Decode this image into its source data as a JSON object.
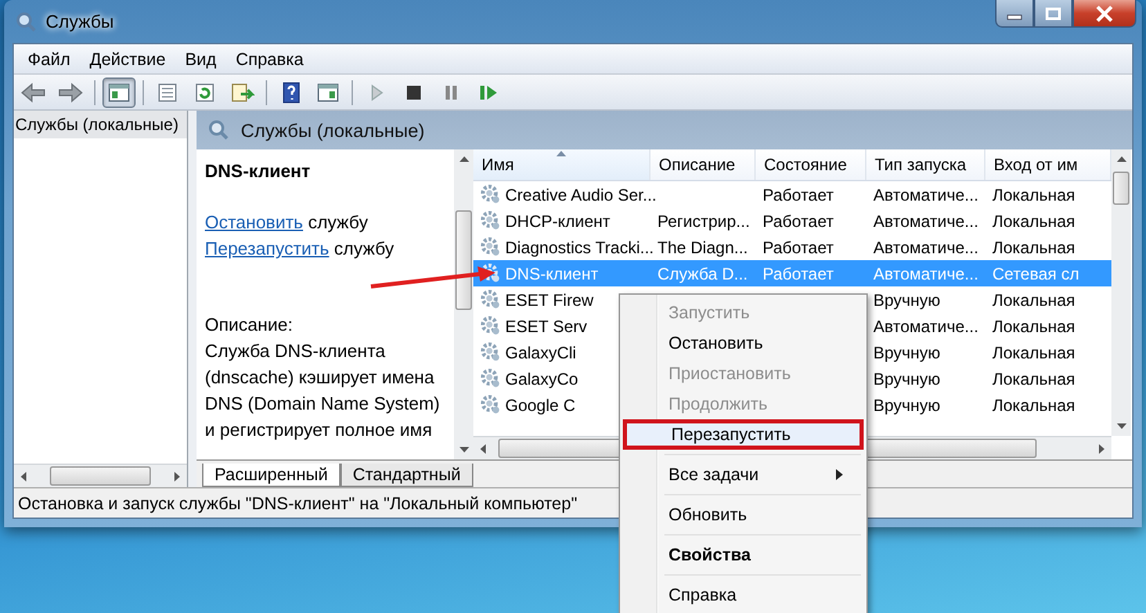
{
  "window": {
    "title": "Службы"
  },
  "menu_bar": [
    "Файл",
    "Действие",
    "Вид",
    "Справка"
  ],
  "toolbar": [
    {
      "kind": "back",
      "pressed": false
    },
    {
      "kind": "forward",
      "pressed": false
    },
    {
      "kind": "sep"
    },
    {
      "kind": "tree",
      "pressed": true
    },
    {
      "kind": "sep"
    },
    {
      "kind": "properties",
      "pressed": false
    },
    {
      "kind": "refresh",
      "pressed": false
    },
    {
      "kind": "export",
      "pressed": false
    },
    {
      "kind": "sep"
    },
    {
      "kind": "help",
      "pressed": false
    },
    {
      "kind": "pane",
      "pressed": false
    },
    {
      "kind": "sep"
    },
    {
      "kind": "play",
      "pressed": false
    },
    {
      "kind": "stop",
      "pressed": false
    },
    {
      "kind": "pause",
      "pressed": false
    },
    {
      "kind": "resume",
      "pressed": false
    }
  ],
  "tree": {
    "items": [
      {
        "label": "Службы (локальные)",
        "selected": true
      }
    ]
  },
  "pane": {
    "title": "Службы (локальные)"
  },
  "details": {
    "service_name": "DNS-клиент",
    "actions": [
      {
        "link": "Остановить",
        "text": "службу"
      },
      {
        "link": "Перезапустить",
        "text": "службу"
      }
    ],
    "description_label": "Описание:",
    "description": "Служба DNS-клиента (dnscache) кэширует имена DNS (Domain Name System) и регистрирует полное имя"
  },
  "table": {
    "columns": [
      {
        "label": "Имя",
        "sorted": true
      },
      {
        "label": "Описание",
        "sorted": false
      },
      {
        "label": "Состояние",
        "sorted": false
      },
      {
        "label": "Тип запуска",
        "sorted": false
      },
      {
        "label": "Вход от им",
        "sorted": false
      }
    ],
    "rows": [
      {
        "name": "Creative Audio Ser...",
        "status": "Работает",
        "startup": "Автоматиче...",
        "logon": "Локальная",
        "selected": false
      },
      {
        "name": "DHCP-клиент",
        "description": "Регистрир...",
        "status": "Работает",
        "startup": "Автоматиче...",
        "logon": "Локальная",
        "selected": false
      },
      {
        "name": "Diagnostics Tracki...",
        "description": "The Diagn...",
        "status": "Работает",
        "startup": "Автоматиче...",
        "logon": "Локальная",
        "selected": false
      },
      {
        "name": "DNS-клиент",
        "description": "Служба D...",
        "status": "Работает",
        "startup": "Автоматиче...",
        "logon": "Сетевая сл",
        "selected": true
      },
      {
        "name": "ESET Firew",
        "startup": "Вручную",
        "logon": "Локальная",
        "selected": false
      },
      {
        "name": "ESET Serv",
        "startup": "Автоматиче...",
        "logon": "Локальная",
        "selected": false
      },
      {
        "name": "GalaxyCli",
        "startup": "Вручную",
        "logon": "Локальная",
        "selected": false
      },
      {
        "name": "GalaxyCo",
        "startup": "Вручную",
        "logon": "Локальная",
        "selected": false
      },
      {
        "name": "Google C",
        "startup": "Вручную",
        "logon": "Локальная",
        "selected": false
      }
    ]
  },
  "tabs": [
    {
      "label": "Расширенный",
      "selected": true
    },
    {
      "label": "Стандартный",
      "selected": false
    }
  ],
  "status_bar": "Остановка и запуск службы \"DNS-клиент\" на \"Локальный компьютер\"",
  "context_menu": [
    {
      "kind": "item",
      "label": "Запустить",
      "disabled": true,
      "highlighted": false,
      "bold": false,
      "submenu": false
    },
    {
      "kind": "item",
      "label": "Остановить",
      "disabled": false,
      "highlighted": false,
      "bold": false,
      "submenu": false
    },
    {
      "kind": "item",
      "label": "Приостановить",
      "disabled": true,
      "highlighted": false,
      "bold": false,
      "submenu": false
    },
    {
      "kind": "item",
      "label": "Продолжить",
      "disabled": true,
      "highlighted": false,
      "bold": false,
      "submenu": false
    },
    {
      "kind": "item",
      "label": "Перезапустить",
      "disabled": false,
      "highlighted": true,
      "bold": false,
      "submenu": false
    },
    {
      "kind": "separator"
    },
    {
      "kind": "item",
      "label": "Все задачи",
      "disabled": false,
      "highlighted": false,
      "bold": false,
      "submenu": true
    },
    {
      "kind": "separator"
    },
    {
      "kind": "item",
      "label": "Обновить",
      "disabled": false,
      "highlighted": false,
      "bold": false,
      "submenu": false
    },
    {
      "kind": "separator"
    },
    {
      "kind": "item",
      "label": "Свойства",
      "disabled": false,
      "highlighted": false,
      "bold": true,
      "submenu": false
    },
    {
      "kind": "separator"
    },
    {
      "kind": "item",
      "label": "Справка",
      "disabled": false,
      "highlighted": false,
      "bold": false,
      "submenu": false
    }
  ]
}
